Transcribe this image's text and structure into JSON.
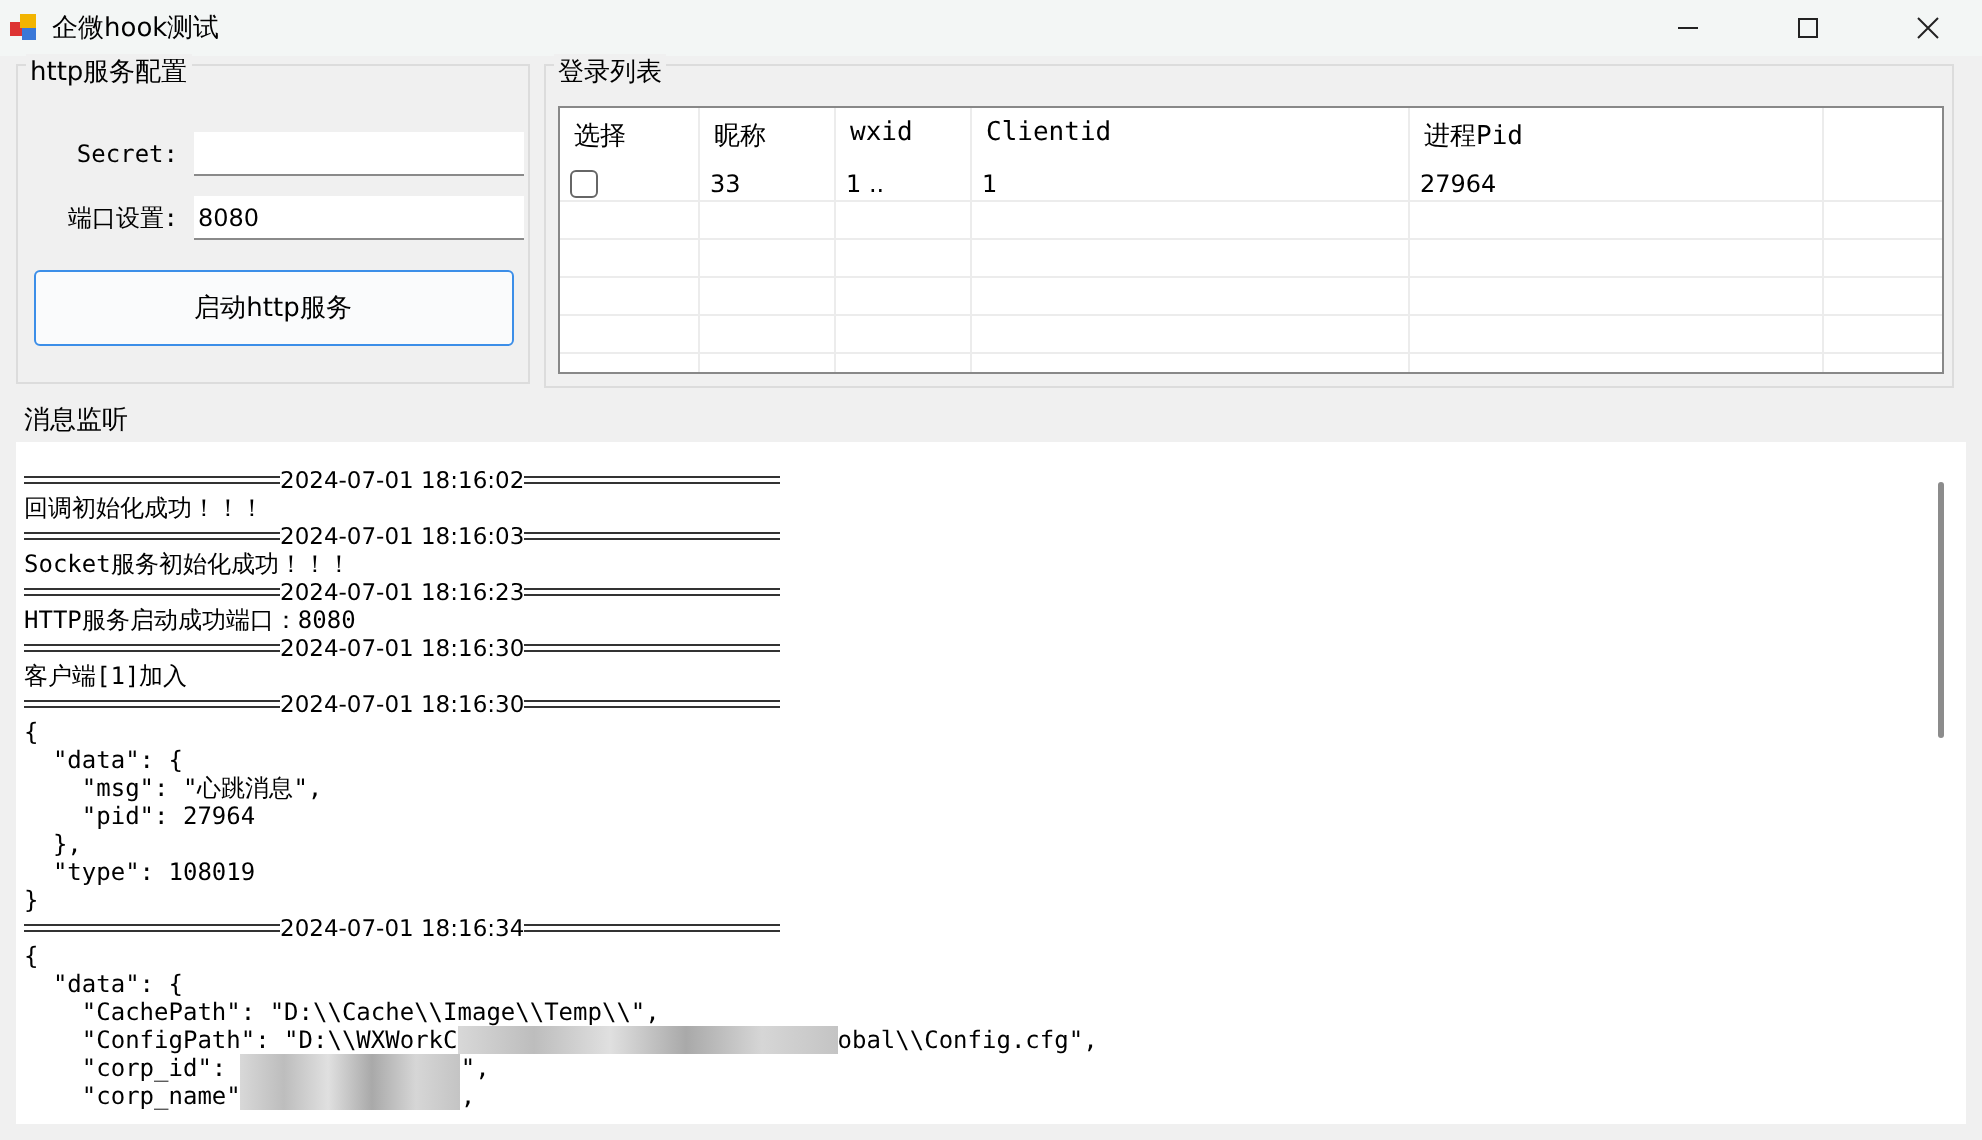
{
  "window": {
    "title": "企微hook测试"
  },
  "http_config": {
    "title": "http服务配置",
    "fields": [
      {
        "label": "Secret:"
      },
      {
        "label": "端口设置:",
        "value": "8080"
      }
    ],
    "button": "启动http服务"
  },
  "login_list": {
    "title": "登录列表",
    "columns": [
      "选择",
      "昵称",
      "wxid",
      "Clientid",
      "进程Pid"
    ],
    "rows": [
      {
        "cells": [
          {
            "kind": "checkbox",
            "checked": false
          },
          {
            "kind": "text",
            "text": "33"
          },
          {
            "kind": "text",
            "text": "1 .."
          },
          {
            "kind": "text",
            "text": "1"
          },
          {
            "kind": "text",
            "text": "27964"
          }
        ]
      }
    ]
  },
  "monitor": {
    "title": "消息监听",
    "lines": [
      {
        "kind": "stamp",
        "text": "2024-07-01 18:16:02"
      },
      {
        "kind": "line",
        "text": "回调初始化成功！！！"
      },
      {
        "kind": "stamp",
        "text": "2024-07-01 18:16:03"
      },
      {
        "kind": "line",
        "text": "Socket服务初始化成功！！！"
      },
      {
        "kind": "stamp",
        "text": "2024-07-01 18:16:23"
      },
      {
        "kind": "line",
        "text": "HTTP服务启动成功端口：8080"
      },
      {
        "kind": "stamp",
        "text": "2024-07-01 18:16:30"
      },
      {
        "kind": "line",
        "text": "客户端[1]加入"
      },
      {
        "kind": "stamp",
        "text": "2024-07-01 18:16:30"
      },
      {
        "kind": "line",
        "text": "{"
      },
      {
        "kind": "line",
        "text": "  \"data\": {"
      },
      {
        "kind": "line",
        "text": "    \"msg\": \"心跳消息\","
      },
      {
        "kind": "line",
        "text": "    \"pid\": 27964"
      },
      {
        "kind": "line",
        "text": "  },"
      },
      {
        "kind": "line",
        "text": "  \"type\": 108019"
      },
      {
        "kind": "line",
        "text": "}"
      },
      {
        "kind": "stamp",
        "text": "2024-07-01 18:16:34"
      },
      {
        "kind": "line",
        "text": "{"
      },
      {
        "kind": "line",
        "text": "  \"data\": {"
      },
      {
        "kind": "line",
        "text": "    \"CachePath\": \"D:\\\\Cache\\\\Image\\\\Temp\\\\\","
      },
      {
        "kind": "masked",
        "before": "    \"ConfigPath\": \"D:\\\\WXWorkC",
        "after": "obal\\\\Config.cfg\","
      },
      {
        "kind": "masked",
        "before": "    \"corp_id\": ",
        "after": "\","
      },
      {
        "kind": "masked",
        "before": "    \"corp_name\"",
        "after": ","
      }
    ]
  }
}
